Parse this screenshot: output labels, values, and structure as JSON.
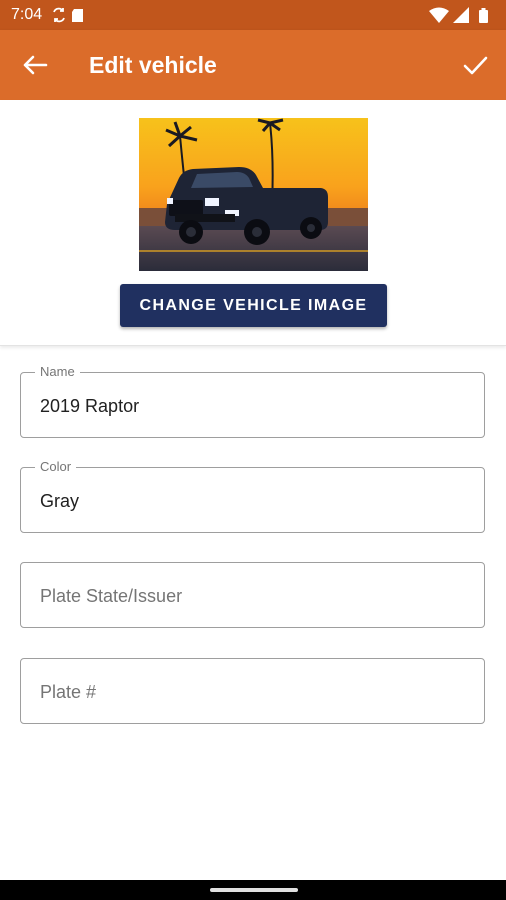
{
  "status_bar": {
    "time": "7:04",
    "left_icons": [
      "sync-icon",
      "sd-card-icon"
    ],
    "right_icons": [
      "wifi-icon",
      "cell-signal-icon",
      "battery-icon"
    ]
  },
  "app_bar": {
    "title": "Edit vehicle",
    "back_icon": "arrow-back-icon",
    "save_icon": "checkmark-icon",
    "color": "#db6c2a",
    "status_color": "#c1561c"
  },
  "vehicle_image": {
    "change_button_label": "CHANGE VEHICLE IMAGE",
    "button_color": "#203060"
  },
  "form": {
    "name": {
      "label": "Name",
      "value": "2019 Raptor"
    },
    "color": {
      "label": "Color",
      "value": "Gray"
    },
    "plate_state": {
      "placeholder": "Plate State/Issuer"
    },
    "plate_number": {
      "placeholder": "Plate #"
    }
  }
}
